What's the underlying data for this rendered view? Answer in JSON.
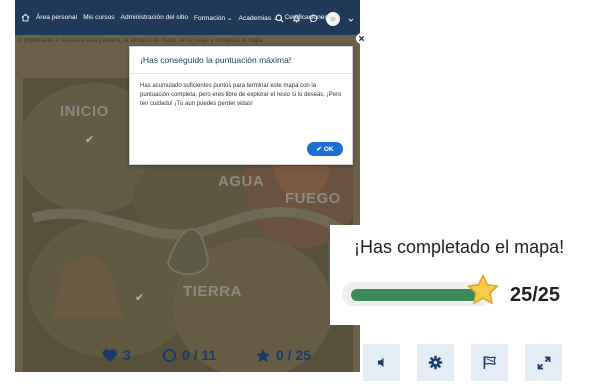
{
  "navbar": {
    "items": [
      "Área personal",
      "Mis cursos",
      "Administración del sitio",
      "Formación ⌄",
      "Academias ⌄",
      "Certificaciones"
    ]
  },
  "breadcrumb": "/// Importante! // Visualiza esta pantalla, la ventana de mapa, en el juego y completa el mapa",
  "map": {
    "labels": [
      "INICIO",
      "AGUA",
      "FUEGO",
      "TIERRA"
    ]
  },
  "modal": {
    "title": "¡Has conseguido la puntuación máxima!",
    "body": "Has acumulado suficientes puntos para terminar este mapa con la puntuación completa, pero eres libre de explorar el resto si lo deseas. ¡Pero ten cuidado! ¡Tú aun puedes perder vidas!",
    "ok_label": "OK"
  },
  "completion": {
    "title": "¡Has completado el mapa!",
    "score": "25/25",
    "progress": 1.0
  },
  "toolbar": {
    "lives": "3",
    "checkpoints": "0 / 11",
    "stars": "0 / 25"
  },
  "colors": {
    "navbar": "#1f3a59",
    "accent_blue": "#1f6fd1",
    "progress_green": "#3b8b5a",
    "toolbar_text": "#1b3a6a",
    "tool_button_bg": "#e4ecf6"
  },
  "icons": [
    "home-icon",
    "search-icon",
    "bell-icon",
    "chat-icon",
    "avatar-icon",
    "close-icon",
    "check-icon",
    "star-icon",
    "heart-icon",
    "circle-icon",
    "volume-icon",
    "gear-icon",
    "flag-icon",
    "expand-icon"
  ]
}
